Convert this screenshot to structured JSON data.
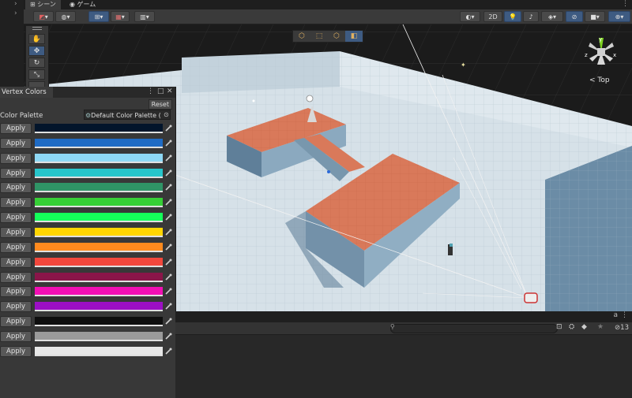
{
  "tabs": {
    "scene": "シーン",
    "game": "ゲーム"
  },
  "toolbar": {
    "two_d": "2D"
  },
  "gizmo": {
    "view_label": "< Top"
  },
  "vertex_colors": {
    "title": "Vertex Colors",
    "reset": "Reset",
    "palette_label": "Color Palette",
    "palette_value": "Default Color Palette (",
    "apply_label": "Apply",
    "colors": [
      "#03152b",
      "#1f6bc4",
      "#8ed8f5",
      "#27c5cb",
      "#2f9466",
      "#36cf36",
      "#14ff5a",
      "#ffd500",
      "#ff8a1e",
      "#f2473c",
      "#8a1549",
      "#f20fb4",
      "#9c0fc4",
      "#0e0e0e",
      "#9a9a9a",
      "#e8e8e8"
    ]
  },
  "bottom_panel": {
    "hidden_count": "13"
  },
  "scene_colors": {
    "platform": "#d9795a",
    "floor": "#d6e1e8",
    "wall": "#6b8ca6",
    "accent": "#3e5b82"
  }
}
